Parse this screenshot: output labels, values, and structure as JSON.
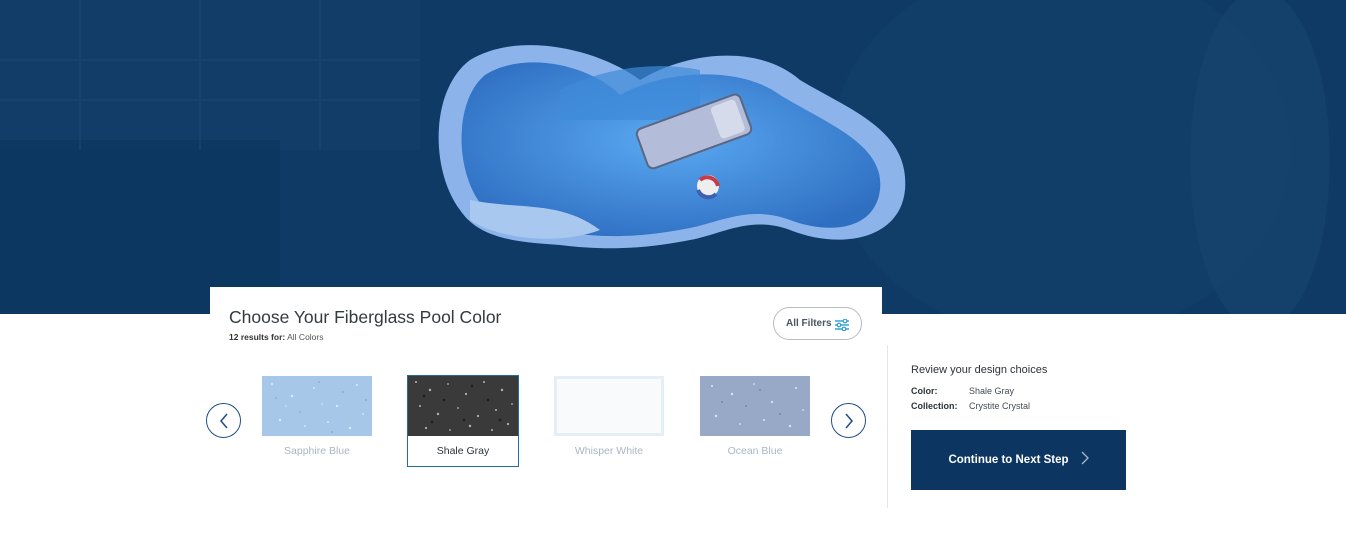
{
  "hero": {
    "image": "fiberglass-pool-aerial-view",
    "colors": {
      "background": "#0e3a66",
      "pool_water": "#3f8ad9",
      "pool_edge": "#8cb4ea"
    }
  },
  "panel": {
    "title": "Choose Your Fiberglass Pool Color",
    "results_count": "12 results for:",
    "results_filter": "All Colors",
    "filters_label": "All Filters",
    "filters_icon": "sliders-icon"
  },
  "carousel": {
    "prev_icon": "chevron-left-icon",
    "next_icon": "chevron-right-icon",
    "swatches": [
      {
        "name": "Sapphire Blue",
        "color": "#a7c7e9",
        "selected": false
      },
      {
        "name": "Shale Gray",
        "color": "#3b3a3a",
        "selected": true
      },
      {
        "name": "Whisper White",
        "color": "#f4f7fa",
        "selected": false
      },
      {
        "name": "Ocean Blue",
        "color": "#97a9c6",
        "selected": false
      }
    ]
  },
  "review": {
    "title": "Review your design choices",
    "color_label": "Color:",
    "color_value": "Shale Gray",
    "collection_label": "Collection:",
    "collection_value": "Crystite Crystal"
  },
  "cta": {
    "label": "Continue to Next Step",
    "icon": "chevron-right-icon",
    "color": "#0c3661"
  }
}
